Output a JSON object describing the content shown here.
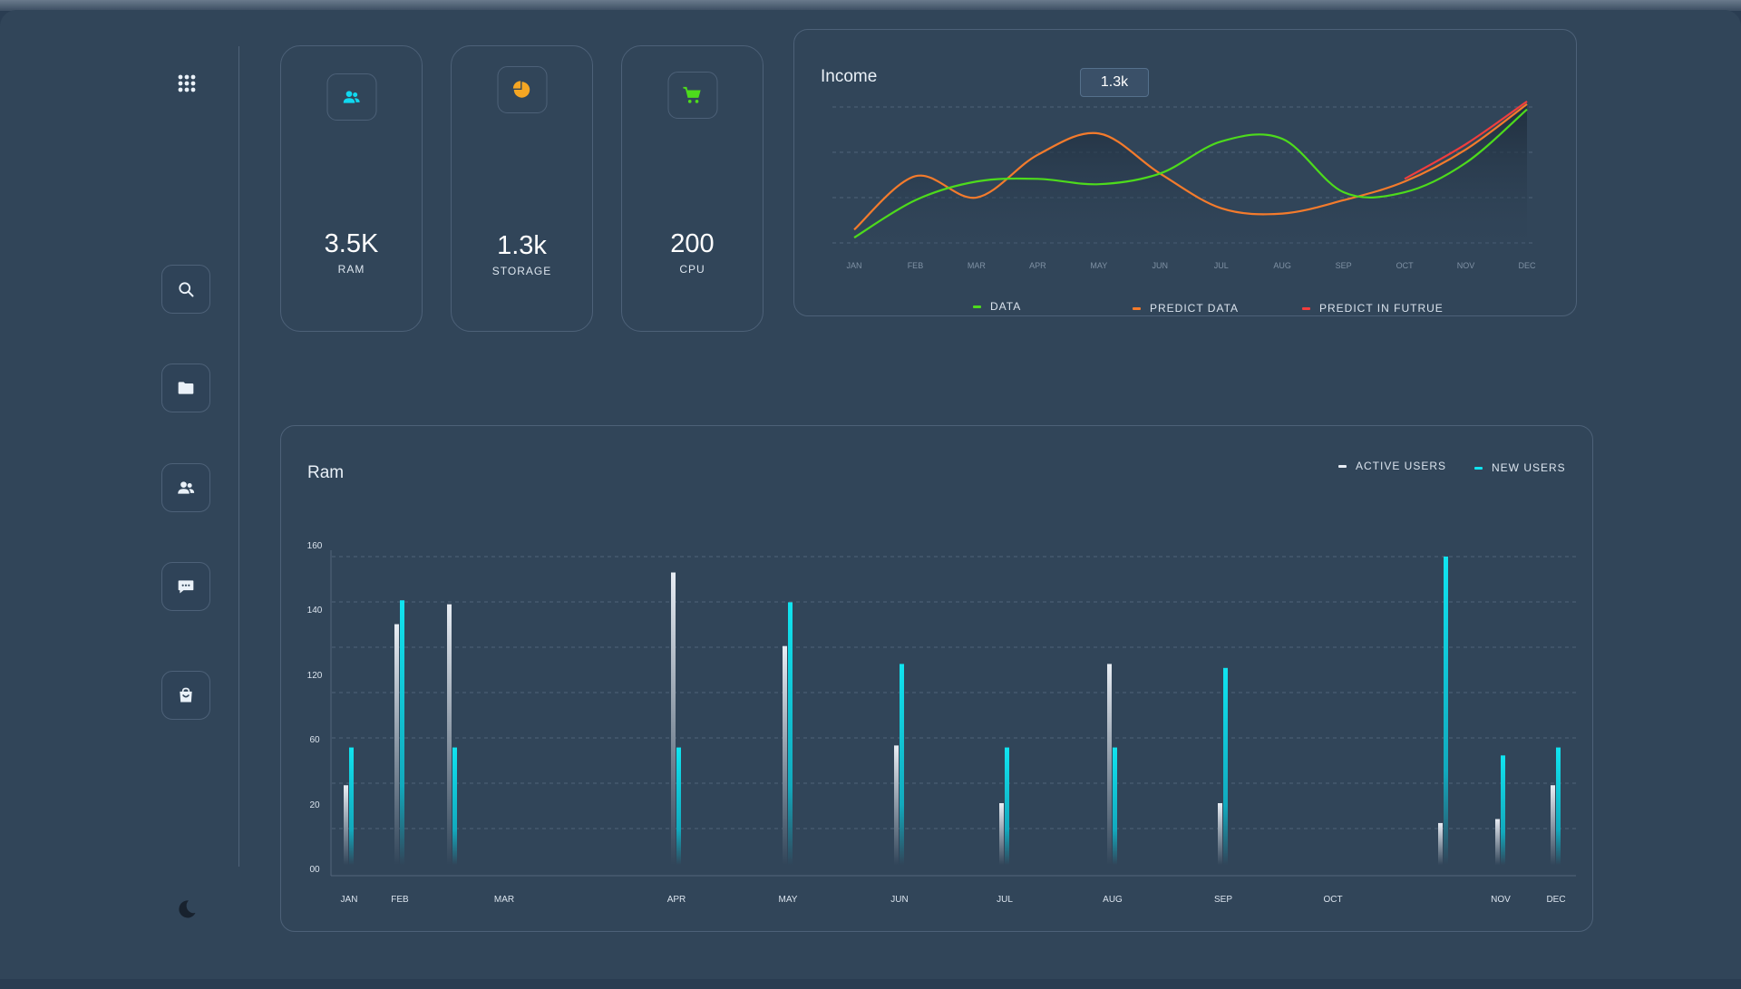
{
  "colors": {
    "background": "#314559",
    "border": "#4d6178",
    "data_green": "#4ddb1c",
    "predict_orange": "#f47b2c",
    "predict_red": "#f23d3d",
    "active_users": "#e8edf4",
    "new_users": "#10e4f0",
    "users_icon": "#10d8f0",
    "storage_icon": "#f5a623",
    "cpu_icon": "#4ddb1c"
  },
  "sidebar": {
    "top_icon": "grid-apps-icon",
    "items": [
      {
        "name": "search",
        "icon": "search-icon"
      },
      {
        "name": "folder",
        "icon": "folder-icon"
      },
      {
        "name": "users",
        "icon": "users-icon"
      },
      {
        "name": "messages",
        "icon": "chat-icon"
      },
      {
        "name": "shop",
        "icon": "shopping-bag-icon"
      }
    ],
    "bottom_icon": "moon-icon"
  },
  "cards": [
    {
      "icon": "users-icon",
      "value": "3.5K",
      "label": "RAM"
    },
    {
      "icon": "pie-chart-icon",
      "value": "1.3k",
      "label": "STORAGE"
    },
    {
      "icon": "cart-icon",
      "value": "200",
      "label": "CPU"
    }
  ],
  "income": {
    "title": "Income",
    "tooltip": "1.3k",
    "legend": [
      {
        "label": "DATA",
        "color": "#4ddb1c"
      },
      {
        "label": "PREDICT DATA",
        "color": "#f47b2c"
      },
      {
        "label": "PREDICT IN FUTRUE",
        "color": "#f23d3d"
      }
    ]
  },
  "ram": {
    "title": "Ram",
    "legend": [
      {
        "label": "ACTIVE USERS",
        "color": "#e8edf4"
      },
      {
        "label": "NEW USERS",
        "color": "#10e4f0"
      }
    ]
  },
  "chart_data": [
    {
      "type": "line",
      "title": "Income",
      "categories": [
        "JAN",
        "FEB",
        "MAR",
        "APR",
        "MAY",
        "JUN",
        "JUL",
        "AUG",
        "SEP",
        "OCT",
        "NOV",
        "DEC"
      ],
      "series": [
        {
          "name": "DATA",
          "values": [
            0.2,
            1.6,
            2.3,
            2.4,
            2.2,
            2.6,
            3.8,
            3.9,
            1.9,
            1.9,
            3.0,
            5.0
          ]
        },
        {
          "name": "PREDICT DATA",
          "values": [
            0.5,
            2.5,
            1.7,
            3.3,
            4.1,
            2.6,
            1.3,
            1.1,
            1.6,
            2.3,
            3.5,
            5.2
          ]
        },
        {
          "name": "PREDICT IN FUTRUE",
          "values": [
            null,
            null,
            null,
            null,
            null,
            null,
            null,
            null,
            null,
            2.4,
            3.7,
            5.3
          ]
        }
      ],
      "ylim": [
        0,
        5.5
      ],
      "grid": true,
      "legend": "bottom"
    },
    {
      "type": "bar",
      "title": "Ram",
      "yticks": [
        "00",
        "20",
        "60",
        "120",
        "140",
        "160"
      ],
      "categories": [
        "JAN",
        "FEB",
        "",
        "MAR",
        "APR",
        "MAY",
        "JUN",
        "JUL",
        "AUG",
        "SEP",
        "OCT",
        "",
        "NOV",
        "DEC"
      ],
      "series": [
        {
          "name": "ACTIVE USERS",
          "values": [
            40,
            121,
            131,
            null,
            147,
            110,
            60,
            31,
            101,
            31,
            null,
            21,
            23,
            40
          ]
        },
        {
          "name": "NEW USERS",
          "values": [
            59,
            133,
            59,
            null,
            59,
            132,
            101,
            59,
            59,
            99,
            null,
            155,
            55,
            59
          ]
        }
      ],
      "ylim": [
        0,
        160
      ],
      "grid": true,
      "legend": "top-right"
    }
  ]
}
